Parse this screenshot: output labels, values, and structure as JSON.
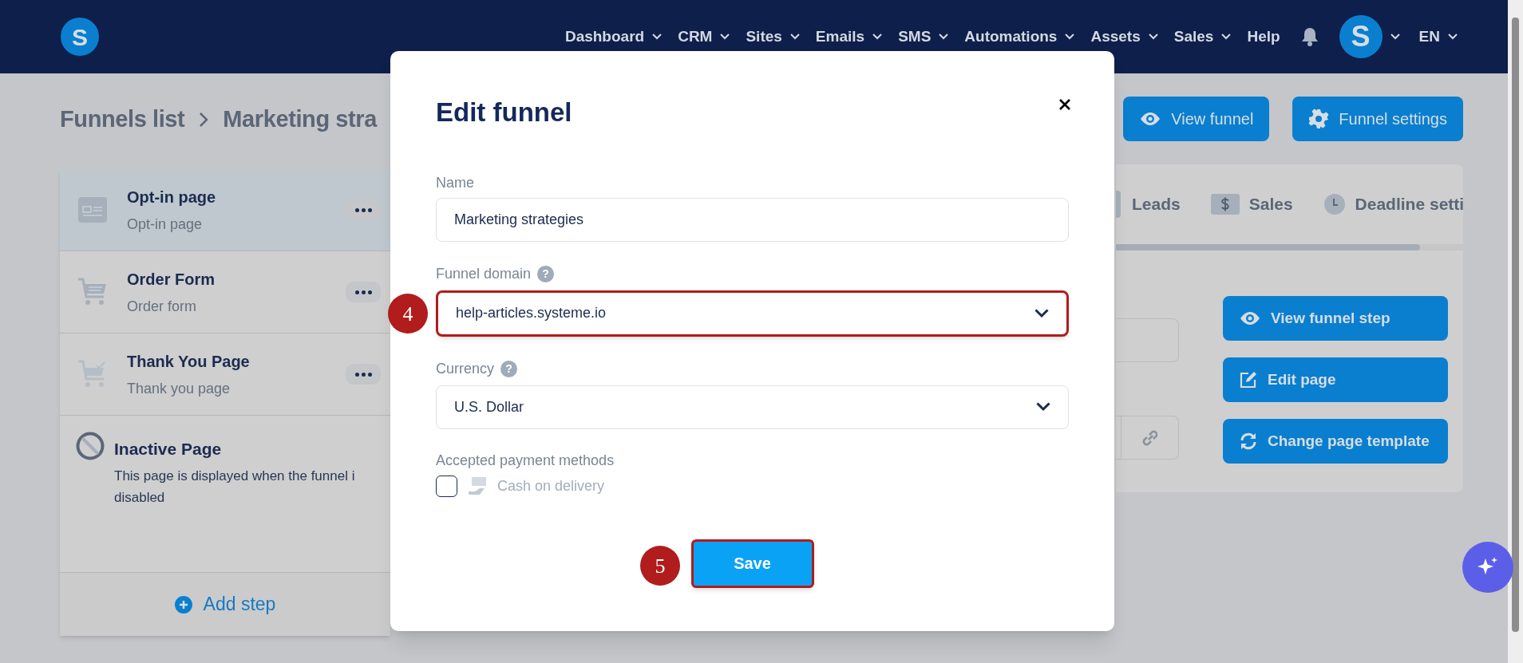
{
  "nav": {
    "logo": "S",
    "items": [
      {
        "label": "Dashboard",
        "dropdown": true
      },
      {
        "label": "CRM",
        "dropdown": true
      },
      {
        "label": "Sites",
        "dropdown": true
      },
      {
        "label": "Emails",
        "dropdown": true
      },
      {
        "label": "SMS",
        "dropdown": true
      },
      {
        "label": "Automations",
        "dropdown": true
      },
      {
        "label": "Assets",
        "dropdown": true
      },
      {
        "label": "Sales",
        "dropdown": true
      },
      {
        "label": "Help",
        "dropdown": false
      }
    ],
    "avatar": "S",
    "language": "EN"
  },
  "breadcrumb": [
    "Funnels list",
    "Marketing stra"
  ],
  "header_buttons": [
    {
      "label": "View funnel",
      "kind": "eye"
    },
    {
      "label": "Funnel settings",
      "kind": "gear"
    }
  ],
  "steps": [
    {
      "kind": "optin",
      "title": "Opt-in page",
      "subtitle": "Opt-in page",
      "selected": true
    },
    {
      "kind": "order",
      "title": "Order Form",
      "subtitle": "Order form",
      "selected": false
    },
    {
      "kind": "thanks",
      "title": "Thank You Page",
      "subtitle": "Thank you page",
      "selected": false
    }
  ],
  "inactive_step": {
    "title": "Inactive Page",
    "description": "This page is displayed when the funnel i\ndisabled"
  },
  "add_step": "Add step",
  "tabs": [
    {
      "label": "Leads",
      "kind": "leads"
    },
    {
      "label": "Sales",
      "kind": "sales"
    },
    {
      "label": "Deadline setti",
      "kind": "deadline"
    }
  ],
  "step_actions": [
    {
      "label": "View funnel step",
      "kind": "eye"
    },
    {
      "label": "Edit page",
      "kind": "edit"
    },
    {
      "label": "Change page template",
      "kind": "refresh"
    }
  ],
  "modal": {
    "title": "Edit funnel",
    "name": {
      "label": "Name",
      "value": "Marketing strategies"
    },
    "domain": {
      "label": "Funnel domain",
      "value": "help-articles.systeme.io",
      "help": "?",
      "highlighted": true,
      "callout": "4"
    },
    "currency": {
      "label": "Currency",
      "help": "?",
      "value": "U.S. Dollar"
    },
    "payment": {
      "label": "Accepted payment methods",
      "options": [
        {
          "label": "Cash on delivery",
          "checked": false
        }
      ]
    },
    "save": {
      "label": "Save",
      "highlighted": true,
      "callout": "5"
    }
  }
}
